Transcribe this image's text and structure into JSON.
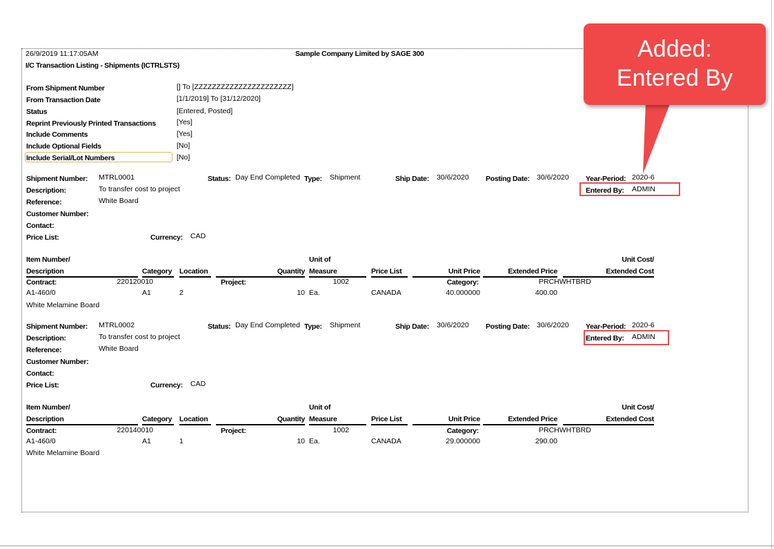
{
  "report": {
    "timestamp": "26/9/2019  11:17:05AM",
    "company": "Sample Company Limited by SAGE 300",
    "title": "I/C Transaction Listing - Shipments (ICTRLSTS)"
  },
  "criteria": [
    {
      "label": "From Shipment Number",
      "value": "[] To [ZZZZZZZZZZZZZZZZZZZZZZ]"
    },
    {
      "label": "From Transaction Date",
      "value": "[1/1/2019]  To  [31/12/2020]"
    },
    {
      "label": "Status",
      "value": "[Entered, Posted]"
    },
    {
      "label": "Reprint Previously Printed Transactions",
      "value": "[Yes]"
    },
    {
      "label": "Include Comments",
      "value": "[Yes]"
    },
    {
      "label": "Include Optional Fields",
      "value": "[No]"
    },
    {
      "label": "Include Serial/Lot Numbers",
      "value": "[No]"
    }
  ],
  "labels": {
    "shipment_number": "Shipment Number:",
    "description": "Description:",
    "reference": "Reference:",
    "customer_number": "Customer Number:",
    "contact": "Contact:",
    "price_list": "Price List:",
    "currency": "Currency:",
    "status": "Status:",
    "type": "Type:",
    "ship_date": "Ship Date:",
    "posting_date": "Posting Date:",
    "year_period": "Year-Period:",
    "entered_by": "Entered By:",
    "contract": "Contract:",
    "project": "Project:",
    "category_colon": "Category:"
  },
  "columns": {
    "item_number": "Item Number/",
    "description": "Description",
    "category": "Category",
    "location": "Location",
    "quantity": "Quantity",
    "unit_of": "Unit of",
    "measure": "Measure",
    "price_list": "Price List",
    "unit_price": "Unit Price",
    "extended_price": "Extended Price",
    "unit_cost": "Unit Cost/",
    "extended_cost": "Extended Cost"
  },
  "shipments": [
    {
      "number": "MTRL0001",
      "status": "Day End Completed",
      "type": "Shipment",
      "ship_date": "30/6/2020",
      "posting_date": "30/6/2020",
      "year_period": "2020-6",
      "entered_by": "ADMIN",
      "description": "To transfer cost to project",
      "reference": "White Board",
      "currency": "CAD",
      "contract": "220120010",
      "project": "1002",
      "category": "PRCHWHTBRD",
      "line": {
        "item": "A1-460/0",
        "category": "A1",
        "location": "2",
        "quantity": "10",
        "uom": "Ea.",
        "price_list": "CANADA",
        "unit_price": "40.000000",
        "extended_price": "400.00",
        "description": "White Melamine Board"
      }
    },
    {
      "number": "MTRL0002",
      "status": "Day End Completed",
      "type": "Shipment",
      "ship_date": "30/6/2020",
      "posting_date": "30/6/2020",
      "year_period": "2020-6",
      "entered_by": "ADMIN",
      "description": "To transfer cost to project",
      "reference": "White Board",
      "currency": "CAD",
      "contract": "220140010",
      "project": "1002",
      "category": "PRCHWHTBRD",
      "line": {
        "item": "A1-460/0",
        "category": "A1",
        "location": "1",
        "quantity": "10",
        "uom": "Ea.",
        "price_list": "CANADA",
        "unit_price": "29.000000",
        "extended_price": "290.00",
        "description": "White Melamine Board"
      }
    }
  ],
  "callout": {
    "line1": "Added:",
    "line2": "Entered By"
  },
  "colors": {
    "callout": "#f04848",
    "highlight_box": "#e05050",
    "serial_box": "#e0b55a"
  }
}
